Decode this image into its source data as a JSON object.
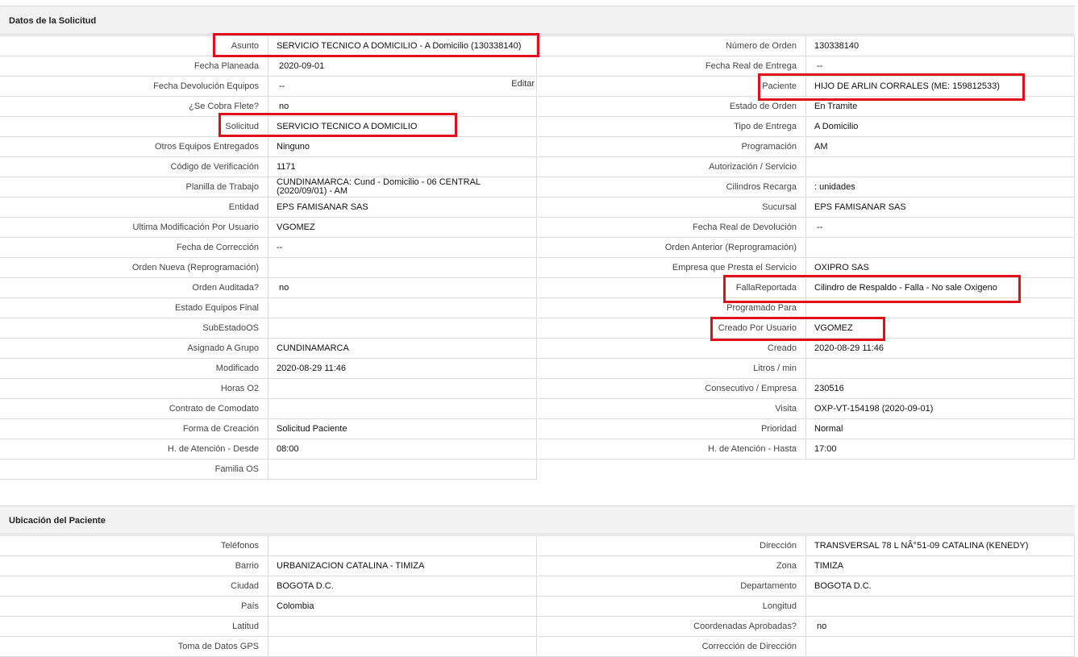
{
  "sections": {
    "solicitud": "Datos de la Solicitud",
    "ubicacion": "Ubicación del Paciente"
  },
  "edit_label": "Editar",
  "solicitud_left": [
    {
      "label": "Asunto",
      "value": "SERVICIO TECNICO A DOMICILIO - A Domicilio (130338140)"
    },
    {
      "label": "Fecha Planeada",
      "value": "2020-09-01"
    },
    {
      "label": "Fecha Devolución Equipos",
      "value": "--"
    },
    {
      "label": "¿Se Cobra Flete?",
      "value": "no"
    },
    {
      "label": "Solicitud",
      "value": "SERVICIO TECNICO A DOMICILIO"
    },
    {
      "label": "Otros Equipos Entregados",
      "value": "Ninguno"
    },
    {
      "label": "Código de Verificación",
      "value": "1171"
    },
    {
      "label": "Planilla de Trabajo",
      "value": "CUNDINAMARCA: Cund - Domicilio - 06 CENTRAL (2020/09/01) - AM"
    },
    {
      "label": "Entidad",
      "value": "EPS FAMISANAR SAS"
    },
    {
      "label": "Ultima Modificación Por Usuario",
      "value": "VGOMEZ"
    },
    {
      "label": "Fecha de Corrección",
      "value": "--"
    },
    {
      "label": "Orden Nueva (Reprogramación)",
      "value": ""
    },
    {
      "label": "Orden Auditada?",
      "value": "no"
    },
    {
      "label": "Estado Equipos Final",
      "value": ""
    },
    {
      "label": "SubEstadoOS",
      "value": ""
    },
    {
      "label": "Asignado A Grupo",
      "value": "CUNDINAMARCA"
    },
    {
      "label": "Modificado",
      "value": "2020-08-29 11:46"
    },
    {
      "label": "Horas O2",
      "value": ""
    },
    {
      "label": "Contrato de Comodato",
      "value": ""
    },
    {
      "label": "Forma de Creación",
      "value": "Solicitud Paciente"
    },
    {
      "label": "H. de Atención - Desde",
      "value": "08:00"
    },
    {
      "label": "Familia OS",
      "value": ""
    }
  ],
  "solicitud_right": [
    {
      "label": "Número de Orden",
      "value": "130338140"
    },
    {
      "label": "Fecha Real de Entrega",
      "value": "--"
    },
    {
      "label": "Paciente",
      "value": "HIJO DE ARLIN CORRALES (ME: 159812533)"
    },
    {
      "label": "Estado de Orden",
      "value": "En Tramite"
    },
    {
      "label": "Tipo de Entrega",
      "value": "A Domicilio"
    },
    {
      "label": "Programación",
      "value": "AM"
    },
    {
      "label": "Autorización / Servicio",
      "value": ""
    },
    {
      "label": "Cilindros Recarga",
      "value": ": unidades"
    },
    {
      "label": "Sucursal",
      "value": "EPS FAMISANAR SAS"
    },
    {
      "label": "Fecha Real de Devolución",
      "value": "--"
    },
    {
      "label": "Orden Anterior (Reprogramación)",
      "value": ""
    },
    {
      "label": "Empresa que Presta el Servicio",
      "value": "OXIPRO SAS"
    },
    {
      "label": "FallaReportada",
      "value": "Cilindro de Respaldo - Falla - No sale Oxigeno"
    },
    {
      "label": "Programado Para",
      "value": ""
    },
    {
      "label": "Creado Por Usuario",
      "value": "VGOMEZ"
    },
    {
      "label": "Creado",
      "value": "2020-08-29 11:46"
    },
    {
      "label": "Litros / min",
      "value": ""
    },
    {
      "label": "Consecutivo / Empresa",
      "value": "230516"
    },
    {
      "label": "Visita",
      "value": "OXP-VT-154198 (2020-09-01)"
    },
    {
      "label": "Prioridad",
      "value": "Normal"
    },
    {
      "label": "H. de Atención - Hasta",
      "value": "17:00"
    }
  ],
  "ubicacion_left": [
    {
      "label": "Teléfonos",
      "value": ""
    },
    {
      "label": "Barrio",
      "value": "URBANIZACION CATALINA - TIMIZA"
    },
    {
      "label": "Ciudad",
      "value": "BOGOTA D.C."
    },
    {
      "label": "País",
      "value": "Colombia"
    },
    {
      "label": "Latitud",
      "value": ""
    },
    {
      "label": "Toma de Datos GPS",
      "value": ""
    }
  ],
  "ubicacion_right": [
    {
      "label": "Dirección",
      "value": "TRANSVERSAL 78 L NÂ°51-09 CATALINA (KENEDY)"
    },
    {
      "label": "Zona",
      "value": "TIMIZA"
    },
    {
      "label": "Departamento",
      "value": "BOGOTA D.C."
    },
    {
      "label": "Longitud",
      "value": ""
    },
    {
      "label": "Coordenadas Aprobadas?",
      "value": "no"
    },
    {
      "label": "Corrección de Dirección",
      "value": ""
    }
  ],
  "highlight_color": "#e0101a"
}
